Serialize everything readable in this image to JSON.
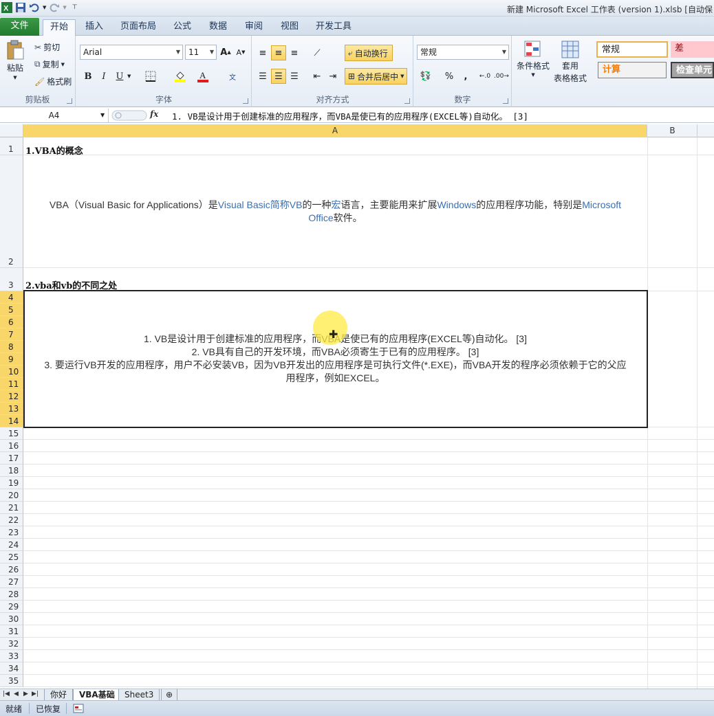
{
  "titlebar": {
    "title": "新建 Microsoft Excel 工作表 (version 1).xlsb [自动保"
  },
  "tabs": [
    "文件",
    "开始",
    "插入",
    "页面布局",
    "公式",
    "数据",
    "审阅",
    "视图",
    "开发工具"
  ],
  "ribbon": {
    "clipboard": {
      "paste": "粘贴",
      "cut": "剪切",
      "copy": "复制",
      "format_painter": "格式刷",
      "label": "剪贴板"
    },
    "font": {
      "name": "Arial",
      "size": "11",
      "label": "字体",
      "bold": "B",
      "italic": "I",
      "underline": "U"
    },
    "alignment": {
      "wrap": "自动换行",
      "merge": "合并后居中",
      "label": "对齐方式"
    },
    "number": {
      "format": "常规",
      "percent": "%",
      "comma": ",",
      "label": "数字"
    },
    "styles": {
      "conditional": "条件格式",
      "table_1": "套用",
      "table_2": "表格格式",
      "normal": "常规",
      "bad": "差",
      "calc": "计算",
      "check": "检查单元"
    }
  },
  "formula_bar": {
    "name_box": "A4",
    "fx": "fx",
    "content": "1. VB是设计用于创建标准的应用程序，而VBA是使已有的应用程序(EXCEL等)自动化。 [3]"
  },
  "columns": [
    "A",
    "B"
  ],
  "rows": [
    "1",
    "2",
    "3",
    "4",
    "5",
    "6",
    "7",
    "8",
    "9",
    "10",
    "11",
    "12",
    "13",
    "14",
    "15",
    "16",
    "17",
    "18",
    "19",
    "20",
    "21",
    "22",
    "23",
    "24",
    "25",
    "26",
    "27",
    "28",
    "29",
    "30",
    "31",
    "32",
    "33",
    "34",
    "35"
  ],
  "cells": {
    "a1": "1.VBA的概念",
    "a2_part1": "VBA（Visual Basic for Applications）是",
    "a2_link1": "Visual Basic简称VB",
    "a2_part2": "的一种",
    "a2_link2": "宏",
    "a2_part3": "语言，主要能用来扩展",
    "a2_link3": "Windows",
    "a2_part4": "的应用程序功能，特别是",
    "a2_link4": "Microsoft",
    "a2_link5": "Office",
    "a2_part5": "软件。",
    "a3": "2.vba和vb的不同之处",
    "a4_line1": "1. VB是设计用于创建标准的应用程序，而VBA是使已有的应用程序(EXCEL等)自动化。 [3]",
    "a4_line2": "2. VB具有自己的开发环境，而VBA必须寄生于已有的应用程序。 [3]",
    "a4_line3": "3. 要运行VB开发的应用程序，用户不必安装VB，因为VB开发出的应用程序是可执行文件(*.EXE)，而VBA开发的程序必须依赖于它的父应",
    "a4_line4": "用程序，例如EXCEL。"
  },
  "sheets": [
    "你好",
    "VBA基础",
    "Sheet3"
  ],
  "status": {
    "ready": "就绪",
    "recovered": "已恢复"
  }
}
